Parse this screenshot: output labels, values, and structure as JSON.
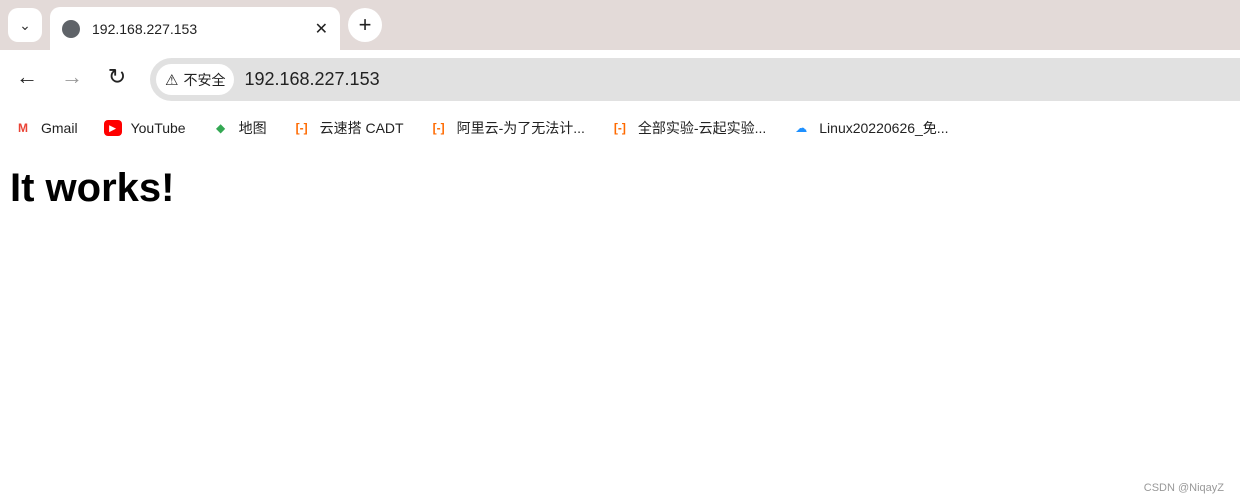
{
  "tab": {
    "title": "192.168.227.153",
    "icon": "globe-icon"
  },
  "address": {
    "security_label": "不安全",
    "url": "192.168.227.153"
  },
  "bookmarks": [
    {
      "label": "Gmail",
      "icon": "gmail-icon",
      "color": "#ea4335"
    },
    {
      "label": "YouTube",
      "icon": "youtube-icon",
      "color": "#ff0000"
    },
    {
      "label": "地图",
      "icon": "maps-icon",
      "color": "#34a853"
    },
    {
      "label": "云速搭 CADT",
      "icon": "aliyun-icon",
      "color": "#ff6a00"
    },
    {
      "label": "阿里云-为了无法计...",
      "icon": "aliyun-icon",
      "color": "#ff6a00"
    },
    {
      "label": "全部实验-云起实验...",
      "icon": "aliyun-icon",
      "color": "#ff6a00"
    },
    {
      "label": "Linux20220626_免...",
      "icon": "cloud-icon",
      "color": "#1e90ff"
    }
  ],
  "page": {
    "heading": "It works!"
  },
  "watermark": "CSDN @NiqayZ"
}
